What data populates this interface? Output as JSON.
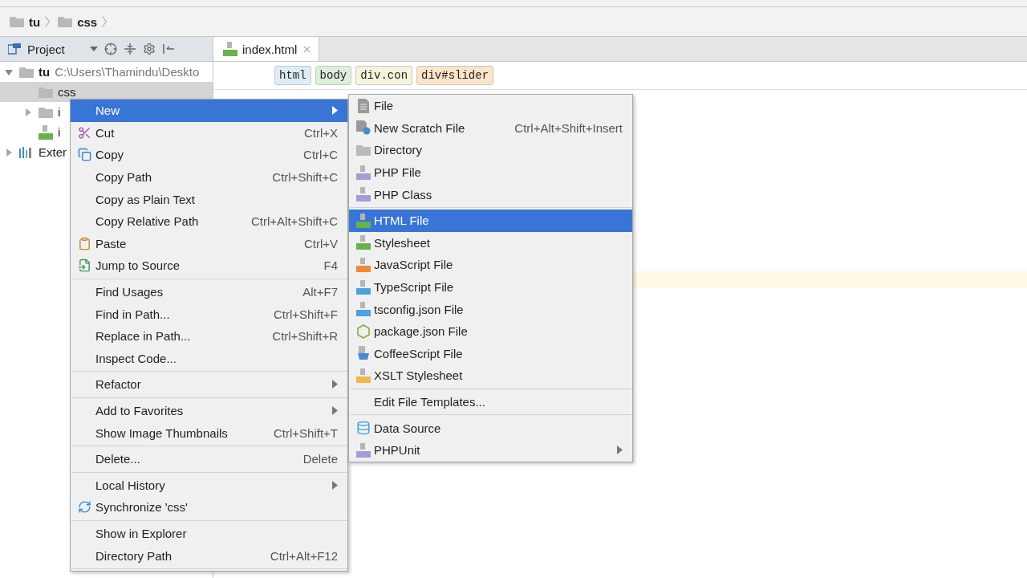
{
  "breadcrumbs": [
    {
      "label": "tu"
    },
    {
      "label": "css"
    }
  ],
  "project_panel": {
    "title": "Project"
  },
  "tree": [
    {
      "label": "tu",
      "path": "C:\\Users\\Thamindu\\Deskto",
      "kind": "folder",
      "expanded": true,
      "selected": false,
      "children": [
        {
          "label": "css",
          "kind": "folder",
          "selected": true
        },
        {
          "label": "i",
          "kind": "folder",
          "expanded": false,
          "selected": false
        },
        {
          "label": "i",
          "kind": "html",
          "selected": false
        }
      ]
    },
    {
      "label": "Exter",
      "kind": "library",
      "expanded": false,
      "selected": false
    }
  ],
  "tabs": [
    {
      "label": "index.html",
      "selected": true
    }
  ],
  "tag_path": [
    {
      "label": "html",
      "color": "#dcedf7"
    },
    {
      "label": "body",
      "color": "#dcefd9"
    },
    {
      "label": "div.con",
      "color": "#f7f3dc"
    },
    {
      "label": "div#slider",
      "color": "#fbe4c9"
    }
  ],
  "context_menu": [
    {
      "kind": "item",
      "label": "New",
      "submenu": true,
      "selected": true
    },
    {
      "kind": "cut",
      "label": "Cut",
      "shortcut": "Ctrl+X",
      "selected": false
    },
    {
      "kind": "copy",
      "label": "Copy",
      "shortcut": "Ctrl+C",
      "selected": false
    },
    {
      "kind": "item",
      "label": "Copy Path",
      "shortcut": "Ctrl+Shift+C",
      "selected": false
    },
    {
      "kind": "item",
      "label": "Copy as Plain Text",
      "selected": false
    },
    {
      "kind": "item",
      "label": "Copy Relative Path",
      "shortcut": "Ctrl+Alt+Shift+C",
      "selected": false
    },
    {
      "kind": "paste",
      "label": "Paste",
      "shortcut": "Ctrl+V",
      "selected": false
    },
    {
      "kind": "jump",
      "label": "Jump to Source",
      "shortcut": "F4",
      "selected": false
    },
    {
      "kind": "separator"
    },
    {
      "kind": "item",
      "label": "Find Usages",
      "shortcut": "Alt+F7",
      "selected": false
    },
    {
      "kind": "item",
      "label": "Find in Path...",
      "shortcut": "Ctrl+Shift+F",
      "selected": false
    },
    {
      "kind": "item",
      "label": "Replace in Path...",
      "shortcut": "Ctrl+Shift+R",
      "selected": false
    },
    {
      "kind": "item",
      "label": "Inspect Code...",
      "selected": false
    },
    {
      "kind": "separator"
    },
    {
      "kind": "item",
      "label": "Refactor",
      "submenu": true,
      "selected": false
    },
    {
      "kind": "separator"
    },
    {
      "kind": "item",
      "label": "Add to Favorites",
      "submenu": true,
      "selected": false
    },
    {
      "kind": "item",
      "label": "Show Image Thumbnails",
      "shortcut": "Ctrl+Shift+T",
      "selected": false
    },
    {
      "kind": "separator"
    },
    {
      "kind": "item",
      "label": "Delete...",
      "shortcut": "Delete",
      "selected": false
    },
    {
      "kind": "separator"
    },
    {
      "kind": "item",
      "label": "Local History",
      "submenu": true,
      "selected": false
    },
    {
      "kind": "sync",
      "label": "Synchronize 'css'",
      "selected": false
    },
    {
      "kind": "separator"
    },
    {
      "kind": "item",
      "label": "Show in Explorer",
      "selected": false
    },
    {
      "kind": "item",
      "label": "Directory Path",
      "shortcut": "Ctrl+Alt+F12",
      "selected": false
    },
    {
      "kind": "separator"
    }
  ],
  "new_submenu": [
    {
      "kind": "file",
      "label": "File",
      "selected": false
    },
    {
      "kind": "scratch",
      "label": "New Scratch File",
      "shortcut": "Ctrl+Alt+Shift+Insert",
      "selected": false
    },
    {
      "kind": "folder",
      "label": "Directory",
      "selected": false
    },
    {
      "kind": "php",
      "label": "PHP File",
      "selected": false
    },
    {
      "kind": "php",
      "label": "PHP Class",
      "selected": false
    },
    {
      "kind": "separator"
    },
    {
      "kind": "html",
      "label": "HTML File",
      "selected": true
    },
    {
      "kind": "css",
      "label": "Stylesheet",
      "selected": false
    },
    {
      "kind": "js",
      "label": "JavaScript File",
      "selected": false
    },
    {
      "kind": "ts",
      "label": "TypeScript File",
      "selected": false
    },
    {
      "kind": "json",
      "label": "tsconfig.json File",
      "selected": false
    },
    {
      "kind": "node",
      "label": "package.json File",
      "selected": false
    },
    {
      "kind": "coffee",
      "label": "CoffeeScript File",
      "selected": false
    },
    {
      "kind": "xslt",
      "label": "XSLT Stylesheet",
      "selected": false
    },
    {
      "kind": "separator"
    },
    {
      "kind": "item",
      "label": "Edit File Templates...",
      "selected": false
    },
    {
      "kind": "separator"
    },
    {
      "kind": "db",
      "label": "Data Source",
      "selected": false
    },
    {
      "kind": "phpunit",
      "label": "PHPUnit",
      "submenu": true,
      "selected": false
    }
  ]
}
